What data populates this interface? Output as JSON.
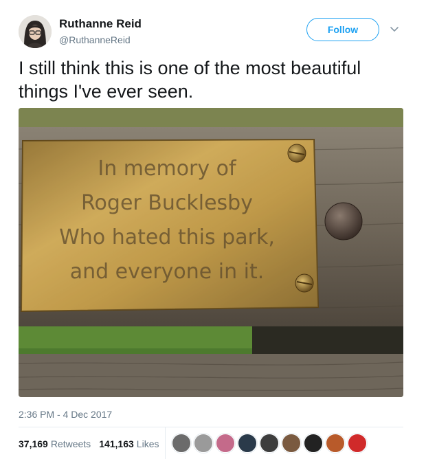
{
  "author": {
    "display_name": "Ruthanne Reid",
    "handle": "@RuthanneReid"
  },
  "follow_label": "Follow",
  "tweet": {
    "text": "I still think this is one of the most beautiful things I've ever seen.",
    "timestamp": "2:36 PM - 4 Dec 2017"
  },
  "photo": {
    "plaque_lines": [
      "In memory of",
      "Roger Bucklesby",
      "Who hated this park,",
      "and everyone in it."
    ]
  },
  "stats": {
    "retweets_count": "37,169",
    "retweets_label": "Retweets",
    "likes_count": "141,163",
    "likes_label": "Likes"
  },
  "likers_colors": [
    "#6b6b6b",
    "#9a9a9a",
    "#c46a8a",
    "#2a3a4a",
    "#3d3d3d",
    "#7a5a40",
    "#222222",
    "#b85a2a",
    "#d02a2a"
  ],
  "colors": {
    "accent": "#1da1f2",
    "text": "#14171a",
    "muted": "#657786"
  }
}
